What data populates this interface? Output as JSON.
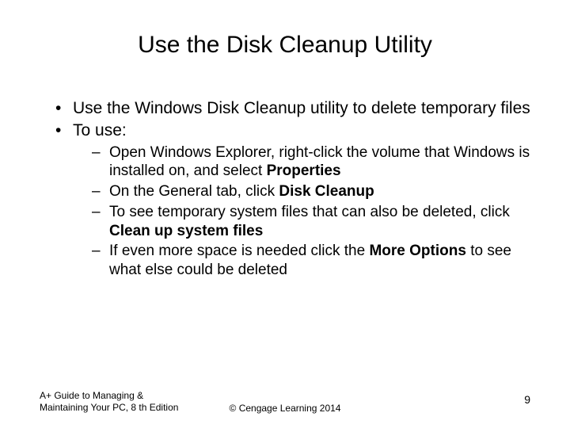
{
  "title": "Use the Disk Cleanup Utility",
  "bullets": {
    "b1": "Use the Windows Disk Cleanup utility to delete temporary files",
    "b2": "To use:",
    "s1a": "Open Windows Explorer, right-click the volume that Windows is installed on, and select ",
    "s1b": "Properties",
    "s2a": "On the General tab, click ",
    "s2b": "Disk Cleanup",
    "s3a": "To see temporary system files that can also be deleted, click ",
    "s3b": "Clean up system files",
    "s4a": "If even more space is needed click the ",
    "s4b": "More Options",
    "s4c": " to see what else could be deleted"
  },
  "footer": {
    "left1": "A+ Guide to Managing &",
    "left2": "Maintaining Your PC, 8 th Edition",
    "center": "© Cengage Learning  2014",
    "pagenum": "9"
  }
}
